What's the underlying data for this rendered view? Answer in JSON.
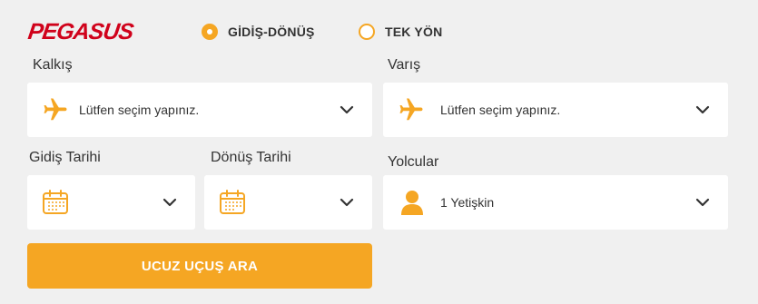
{
  "brand": {
    "logo_text": "PEGASUS",
    "logo_color": "#d0021b"
  },
  "colors": {
    "accent": "#f5a623",
    "field_bg": "#ffffff",
    "page_bg": "#f0f0f0"
  },
  "trip_type": {
    "selected": "round_trip",
    "options": [
      {
        "id": "round_trip",
        "label": "GİDİŞ-DÖNÜŞ",
        "checked": true
      },
      {
        "id": "one_way",
        "label": "TEK YÖN",
        "checked": false
      }
    ]
  },
  "origin": {
    "label": "Kalkış",
    "placeholder": "Lütfen seçim yapınız.",
    "icon": "airplane-icon"
  },
  "destination": {
    "label": "Varış",
    "placeholder": "Lütfen seçim yapınız.",
    "icon": "airplane-icon"
  },
  "departure_date": {
    "label": "Gidiş Tarihi",
    "value": "",
    "icon": "calendar-icon"
  },
  "return_date": {
    "label": "Dönüş Tarihi",
    "value": "",
    "icon": "calendar-icon"
  },
  "passengers": {
    "label": "Yolcular",
    "value": "1 Yetişkin",
    "icon": "person-icon"
  },
  "search_button": {
    "label": "UCUZ UÇUŞ ARA"
  }
}
